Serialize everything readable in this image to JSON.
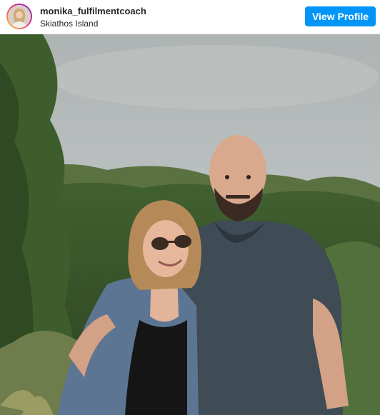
{
  "post": {
    "username": "monika_fulfilmentcoach",
    "location": "Skiathos Island",
    "view_profile_label": "View Profile"
  },
  "icons": {
    "avatar": "profile-photo",
    "photo": "couple-in-forest"
  },
  "colors": {
    "button": "#0095f6",
    "text": "#262626"
  }
}
